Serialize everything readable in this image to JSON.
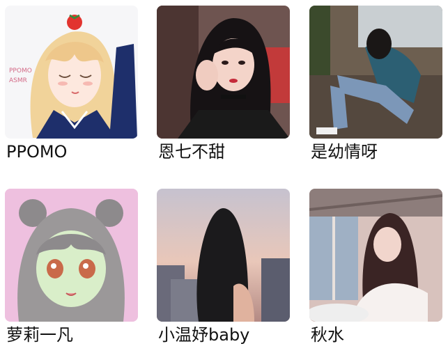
{
  "avatars": [
    {
      "name": "PPOMO",
      "image_text": "PPOMO ASMR",
      "image": "anime-girl-blonde-sailor-uniform-with-tomato"
    },
    {
      "name": "恩七不甜",
      "image": "girl-dark-hair-black-choker"
    },
    {
      "name": "是幼情呀",
      "image": "girl-jeans-sitting-on-sofa"
    },
    {
      "name": "萝莉一凡",
      "image": "anime-girl-grey-hair-bun-pink-background"
    },
    {
      "name": "小温妤baby",
      "image": "girl-back-view-city-sunset"
    },
    {
      "name": "秋水",
      "image": "girl-white-blouse-by-window"
    }
  ]
}
